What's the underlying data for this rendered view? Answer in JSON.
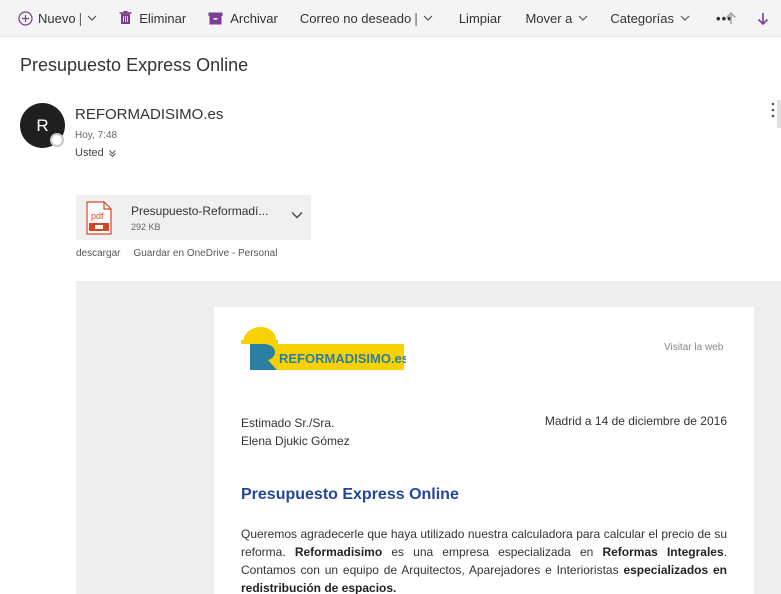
{
  "toolbar": {
    "new_label": "Nuevo",
    "delete_label": "Eliminar",
    "archive_label": "Archivar",
    "junk_label": "Correo no deseado",
    "sweep_label": "Limpiar",
    "move_label": "Mover a",
    "categories_label": "Categorías",
    "more_label": "•••"
  },
  "message": {
    "subject": "Presupuesto Express Online",
    "avatar_initial": "R",
    "sender": "REFORMADISIMO.es",
    "time": "Hoy, 7:48",
    "to": "Usted"
  },
  "attachment": {
    "name": "Presupuesto-Reformadí...",
    "size": "292 KB",
    "icon_label": "pdf",
    "download_label": "descargar",
    "onedrive_label": "Guardar en OneDrive - Personal"
  },
  "email": {
    "logo_text": "REFORMADISIMO.es",
    "visit_web": "Visitar la web",
    "greeting": "Estimado Sr./Sra.",
    "recipient_name": "Elena Djukic Gómez",
    "date": "Madrid a 14 de diciembre de 2016",
    "heading": "Presupuesto Express Online",
    "p1": "Queremos agradecerle que haya utilizado nuestra calculadora para calcular el precio de su reforma. ",
    "p1_b1": "Reformadisimo",
    "p2": " es una empresa especializada en ",
    "p2_b2": "Reformas Integrales",
    "p3": ". Contamos con un equipo de Arquitectos, Aparejadores e Interioristas ",
    "p3_b3": "especializados en redistribución de espacios."
  },
  "colors": {
    "accent_purple": "#7a3f8f",
    "logo_yellow": "#f7d200",
    "logo_teal": "#2b7fa0",
    "heading_blue": "#24469a"
  }
}
